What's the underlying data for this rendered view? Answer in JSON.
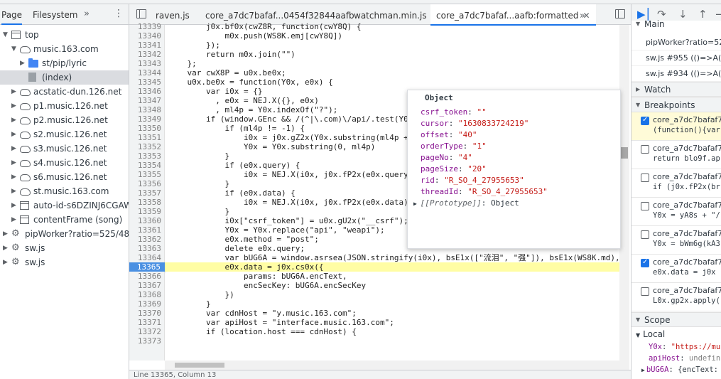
{
  "navigator": {
    "tabs": [
      "Page",
      "Filesystem"
    ],
    "tree": [
      {
        "label": "top",
        "indent": 0,
        "icon": "frame",
        "expanded": true
      },
      {
        "label": "music.163.com",
        "indent": 1,
        "icon": "cloud",
        "expanded": true
      },
      {
        "label": "st/pip/lyric",
        "indent": 2,
        "icon": "folder",
        "expanded": false
      },
      {
        "label": "(index)",
        "indent": 2,
        "icon": "file",
        "selected": true
      },
      {
        "label": "acstatic-dun.126.net",
        "indent": 1,
        "icon": "cloud",
        "expanded": false
      },
      {
        "label": "p1.music.126.net",
        "indent": 1,
        "icon": "cloud",
        "expanded": false
      },
      {
        "label": "p2.music.126.net",
        "indent": 1,
        "icon": "cloud",
        "expanded": false
      },
      {
        "label": "s2.music.126.net",
        "indent": 1,
        "icon": "cloud",
        "expanded": false
      },
      {
        "label": "s3.music.126.net",
        "indent": 1,
        "icon": "cloud",
        "expanded": false
      },
      {
        "label": "s4.music.126.net",
        "indent": 1,
        "icon": "cloud",
        "expanded": false
      },
      {
        "label": "s6.music.126.net",
        "indent": 1,
        "icon": "cloud",
        "expanded": false
      },
      {
        "label": "st.music.163.com",
        "indent": 1,
        "icon": "cloud",
        "expanded": false
      },
      {
        "label": "auto-id-s6DZINJ6CGAWFO",
        "indent": 1,
        "icon": "frame",
        "expanded": false
      },
      {
        "label": "contentFrame (song)",
        "indent": 1,
        "icon": "frame",
        "expanded": false
      },
      {
        "label": "pipWorker?ratio=525/480*1",
        "indent": 0,
        "icon": "gear",
        "expanded": false
      },
      {
        "label": "sw.js",
        "indent": 0,
        "icon": "gear",
        "expanded": false
      },
      {
        "label": "sw.js",
        "indent": 0,
        "icon": "gear",
        "expanded": false
      }
    ]
  },
  "editor": {
    "tabs": [
      "raven.js",
      "core_a7dc7bafaf...0454f32844aafb",
      "watchman.min.js",
      "core_a7dc7bafaf...aafb:formatted"
    ],
    "active_tab": 3,
    "current_line": 13365,
    "lines": [
      {
        "n": 13339,
        "t": "        j0x.bf0x(cwZ8R, function(cwY8Q) {"
      },
      {
        "n": 13340,
        "t": "            m0x.push(WS8K.emj[cwY8Q])"
      },
      {
        "n": 13341,
        "t": "        });"
      },
      {
        "n": 13342,
        "t": "        return m0x.join(\"\")"
      },
      {
        "n": 13343,
        "t": "    };"
      },
      {
        "n": 13344,
        "t": "    var cwX8P = u0x.be0x;"
      },
      {
        "n": 13345,
        "t": "    u0x.be0x = function(Y0x, e0x) {"
      },
      {
        "n": 13346,
        "t": "        var i0x = {}"
      },
      {
        "n": 13347,
        "t": "          , e0x = NEJ.X({}, e0x)"
      },
      {
        "n": 13348,
        "t": "          , ml4p = Y0x.indexOf(\"?\");"
      },
      {
        "n": 13349,
        "t": "        if (window.GEnc && /(^|\\.com)\\/api/.test(Y0x"
      },
      {
        "n": 13350,
        "t": "            if (ml4p != -1) {"
      },
      {
        "n": 13351,
        "t": "                i0x = j0x.gZ2x(Y0x.substring(ml4p + "
      },
      {
        "n": 13352,
        "t": "                Y0x = Y0x.substring(0, ml4p)"
      },
      {
        "n": 13353,
        "t": "            }"
      },
      {
        "n": 13354,
        "t": "            if (e0x.query) {"
      },
      {
        "n": 13355,
        "t": "                i0x = NEJ.X(i0x, j0x.fP2x(e0x.query)"
      },
      {
        "n": 13356,
        "t": "            }"
      },
      {
        "n": 13357,
        "t": "            if (e0x.data) {"
      },
      {
        "n": 13358,
        "t": "                i0x = NEJ.X(i0x, j0x.fP2x(e0x.data)"
      },
      {
        "n": 13359,
        "t": "            }"
      },
      {
        "n": 13360,
        "t": "            i0x[\"csrf_token\"] = u0x.gU2x(\"__csrf\");"
      },
      {
        "n": 13361,
        "t": "            Y0x = Y0x.replace(\"api\", \"weapi\");"
      },
      {
        "n": 13362,
        "t": "            e0x.method = \"post\";"
      },
      {
        "n": 13363,
        "t": "            delete e0x.query;"
      },
      {
        "n": 13364,
        "t": "            var bUG6A = window.asrsea(JSON.stringify(i0x), bsE1x([\"流泪\", \"强\"]), bsE1x(WS8K.md),"
      },
      {
        "n": 13365,
        "t": "            e0x.data = j0x.cs0x({"
      },
      {
        "n": 13366,
        "t": "                params: bUG6A.encText,"
      },
      {
        "n": 13367,
        "t": "                encSecKey: bUG6A.encSecKey"
      },
      {
        "n": 13368,
        "t": "            })"
      },
      {
        "n": 13369,
        "t": "        }"
      },
      {
        "n": 13370,
        "t": "        var cdnHost = \"y.music.163.com\";"
      },
      {
        "n": 13371,
        "t": "        var apiHost = \"interface.music.163.com\";"
      },
      {
        "n": 13372,
        "t": "        if (location.host === cdnHost) {"
      },
      {
        "n": 13373,
        "t": ""
      }
    ],
    "status_text": "Line 13365, Column 13"
  },
  "popover": {
    "title": "Object",
    "rows": [
      {
        "k": "csrf_token",
        "v": "\"\""
      },
      {
        "k": "cursor",
        "v": "\"1630833724219\""
      },
      {
        "k": "offset",
        "v": "\"40\""
      },
      {
        "k": "orderType",
        "v": "\"1\""
      },
      {
        "k": "pageNo",
        "v": "\"4\""
      },
      {
        "k": "pageSize",
        "v": "\"20\""
      },
      {
        "k": "rid",
        "v": "\"R_SO_4_27955653\""
      },
      {
        "k": "threadId",
        "v": "\"R_SO_4_27955653\""
      }
    ],
    "proto_key": "[[Prototype]]",
    "proto_val": "Object"
  },
  "debugger": {
    "call_stack_header": "Main",
    "call_stack": [
      "pipWorker?ratio=52",
      "sw.js #955 (()=>A(t,",
      "sw.js #934 (()=>A(t,"
    ],
    "watch_label": "Watch",
    "breakpoints_label": "Breakpoints",
    "breakpoints": [
      {
        "file": "core_a7dc7bafaf7c",
        "code": "(function(){var",
        "checked": true,
        "active": true
      },
      {
        "file": "core_a7dc7bafaf7c",
        "code": "return blo9f.ap",
        "checked": false
      },
      {
        "file": "core_a7dc7bafaf7c",
        "code": "if (j0x.fP2x(br",
        "checked": false
      },
      {
        "file": "core_a7dc7bafaf7c",
        "code": "Y0x = yA8s + \"/",
        "checked": false
      },
      {
        "file": "core_a7dc7bafaf7c",
        "code": "Y0x = bWm6g(kA3",
        "checked": false
      },
      {
        "file": "core_a7dc7bafaf7c",
        "code": "e0x.data = j0x",
        "checked": true
      },
      {
        "file": "core_a7dc7bafaf7c",
        "code": "L0x.gp2x.apply(",
        "checked": false
      }
    ],
    "scope_label": "Scope",
    "local_label": "Local",
    "scope": [
      {
        "k": "Y0x",
        "v": "\"https://mu"
      },
      {
        "k": "apiHost",
        "v": "undefin"
      },
      {
        "k": "bUG6A",
        "v": "{encText:"
      }
    ]
  }
}
